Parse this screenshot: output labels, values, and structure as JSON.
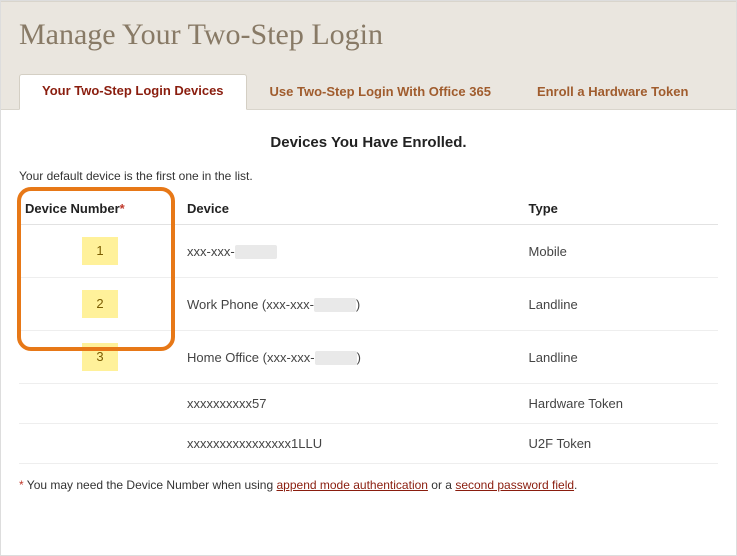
{
  "page_title": "Manage Your Two-Step Login",
  "tabs": [
    {
      "label": "Your Two-Step Login Devices"
    },
    {
      "label": "Use Two-Step Login With Office 365"
    },
    {
      "label": "Enroll a Hardware Token"
    }
  ],
  "section_title": "Devices You Have Enrolled.",
  "intro_text": "Your default device is the first one in the list.",
  "columns": {
    "number": "Device Number",
    "number_asterisk": "*",
    "device": "Device",
    "type": "Type"
  },
  "rows": [
    {
      "num": "1",
      "device_prefix": "xxx-xxx-",
      "device_suffix": "",
      "redacted": true,
      "type": "Mobile",
      "highlighted": true
    },
    {
      "num": "2",
      "device_prefix": "Work Phone (xxx-xxx-",
      "device_suffix": ")",
      "redacted": true,
      "type": "Landline",
      "highlighted": true
    },
    {
      "num": "3",
      "device_prefix": "Home Office (xxx-xxx-",
      "device_suffix": ")",
      "redacted": true,
      "type": "Landline",
      "highlighted": true
    },
    {
      "num": "",
      "device_prefix": "xxxxxxxxxx57",
      "device_suffix": "",
      "redacted": false,
      "type": "Hardware Token",
      "highlighted": false
    },
    {
      "num": "",
      "device_prefix": "xxxxxxxxxxxxxxxx1LLU",
      "device_suffix": "",
      "redacted": false,
      "type": "U2F Token",
      "highlighted": false
    }
  ],
  "footnote": {
    "asterisk": "*",
    "lead": " You may need the Device Number when using ",
    "link1": "append mode authentication",
    "mid": " or a ",
    "link2": "second password field",
    "tail": "."
  }
}
